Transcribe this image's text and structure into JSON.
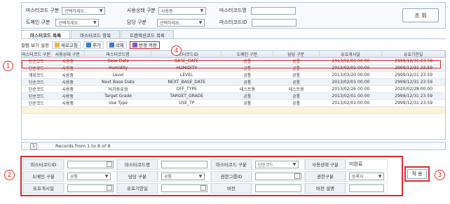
{
  "search": {
    "master_code_type_label": "마스터코드 구분",
    "master_code_type_value": "선택하세요..",
    "usage_status_label": "사용상태 구분",
    "usage_status_value": "사용중",
    "master_code_name_label": "마스터코드명",
    "domain_type_label": "도메인 구분",
    "domain_type_value": "선택하세요..",
    "owner_type_label": "담당 구분",
    "owner_type_value": "선택하세요..",
    "master_code_id_label": "마스터코드ID",
    "search_button": "조 회"
  },
  "tabs": [
    "마스터코드 목록",
    "마스터코드 항목",
    "트랜잭션코드 목록"
  ],
  "toolbar": {
    "column_settings": "컬럼 보기 설정",
    "refresh": "새로고침",
    "add": "추가",
    "delete": "삭제",
    "apply_changes": "변경 적용"
  },
  "grid": {
    "headers": [
      "마스터코드 구분",
      "사용상태 구분",
      "마스터코드명",
      "마스터코드ID",
      "도메인 구분",
      "담당 구분",
      "유효개시일",
      "유효기한일"
    ],
    "rows": [
      [
        "단순코드",
        "사용중",
        "Base Date",
        "BASE_DATE",
        "공통",
        "공통",
        "2013/02/01 00:00",
        "2999/12/31 23:59"
      ],
      [
        "단순코드",
        "사용중",
        "Humidity",
        "HUMIDITY",
        "공통",
        "공통",
        "2013/02/01 00:00",
        "2999/12/31 23:59"
      ],
      [
        "계위코드",
        "사용중",
        "Level",
        "LEVEL",
        "공통",
        "공통",
        "2013/03/20 00:00",
        "2999/12/31 23:59"
      ],
      [
        "단순코드",
        "사용중",
        "Next Base Date",
        "NEXT_BASE_DATE",
        "공통",
        "공통",
        "2013/02/01 00:00",
        "2999/12/31 23:59"
      ],
      [
        "단순코드",
        "사용중",
        "비가동유형",
        "OFF_TYPE",
        "테스트용",
        "테스트용",
        "2013/02/26 00:00",
        "2020/02/28 00:00"
      ],
      [
        "단순코드",
        "사용중",
        "Target Grade",
        "TARGET_GRADE",
        "공통",
        "공통",
        "2013/02/01 00:00",
        "2999/12/31 23:59"
      ],
      [
        "단순코드",
        "사용중",
        "Use Type",
        "USE_TP",
        "공통",
        "공통",
        "2013/02/01 00:00",
        "2999/12/31 23:59"
      ]
    ]
  },
  "pager": {
    "page": "1",
    "summary": "Records from 1 to 8 of 8"
  },
  "form": {
    "master_code_id": "마스터코드ID",
    "master_code_name": "마스터코드명",
    "master_code_type": "마스터코드 구분",
    "master_code_type_value": "단순코드",
    "usage_status": "사용상태 구분",
    "usage_status_value": "미완료",
    "domain_type": "도메인 구분",
    "domain_type_value": "공통",
    "owner_type": "담당 구분",
    "owner_type_value": "공통",
    "auth_group_id": "권한그룹ID",
    "auth_type": "권한구분",
    "auth_type_value": "등록자",
    "valid_start": "유효개시일",
    "valid_end": "유효기한일",
    "version": "버전",
    "version_desc": "버전 설명",
    "apply_button": "적 용"
  },
  "annotations": {
    "n1": "1",
    "n2": "2",
    "n3": "3",
    "n4": "4"
  },
  "colors": {
    "accent_red": "#e02828",
    "grid_alt": "#eef2f9",
    "border": "#b9c7d8"
  }
}
